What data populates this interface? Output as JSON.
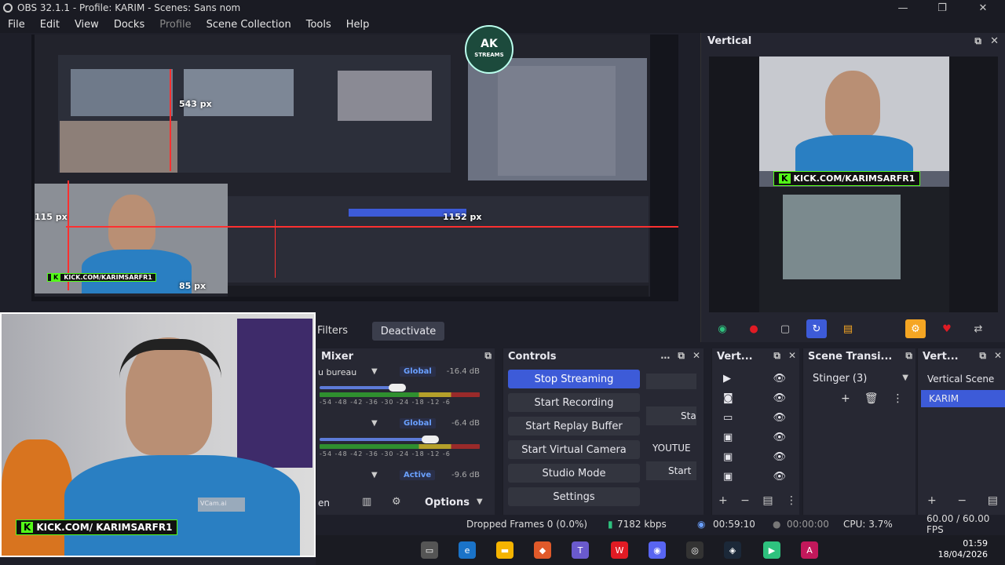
{
  "window": {
    "title": "OBS 32.1.1 - Profile: KARIM - Scenes: Sans nom",
    "controls": [
      "—",
      "❐",
      "✕"
    ]
  },
  "menu": {
    "items": [
      "File",
      "Edit",
      "View",
      "Docks",
      "Profile",
      "Scene Collection",
      "Tools",
      "Help"
    ]
  },
  "preview": {
    "labels": {
      "top": "543 px",
      "right": "1152 px",
      "left": "115 px",
      "bottom": "85 px"
    },
    "kick_text": "KICK.COM/KARIMSARFR1"
  },
  "logo": {
    "main": "AK",
    "sub": "STREAMS"
  },
  "vertical_dock": {
    "title": "Vertical",
    "kick_text": "KICK.COM/KARIMSARFR1"
  },
  "webcam": {
    "kick_text": "KICK.COM/ KARIMSARFR1",
    "watermark": "VCam.ai"
  },
  "toolbar": {
    "filters_label": "Filters",
    "deactivate_label": "Deactivate"
  },
  "mixer": {
    "title": "Mixer",
    "channels": [
      {
        "name": "u bureau",
        "tag": "Global",
        "db": "-16.4 dB"
      },
      {
        "name": "",
        "tag": "Global",
        "db": "-6.4 dB"
      },
      {
        "name": "",
        "tag": "Active",
        "db": "-9.6 dB"
      }
    ],
    "scale": "-54  -48  -42  -36  -30  -24  -18  -12  -6",
    "footer_label": "en",
    "options_label": "Options"
  },
  "controls": {
    "title": "Controls",
    "buttons": [
      "Stop Streaming",
      "Start Recording",
      "Start Replay Buffer",
      "Start Virtual Camera",
      "Studio Mode",
      "Settings"
    ],
    "side_labels": [
      "Sta",
      "YOUTUE",
      "Start"
    ]
  },
  "vert_sources": {
    "title": "Vert..."
  },
  "scene_transitions": {
    "title": "Scene Transi...",
    "selected": "Stinger (3)"
  },
  "vert_scenes": {
    "title": "Vert...",
    "header": "Vertical Scene",
    "selected": "KARIM"
  },
  "status": {
    "dropped": "Dropped Frames 0 (0.0%)",
    "bitrate": "7182 kbps",
    "stream_time": "00:59:10",
    "rec_time": "00:00:00",
    "cpu": "CPU: 3.7%",
    "fps": "60.00 / 60.00 FPS"
  },
  "clock": {
    "time": "01:59",
    "date": "18/04/2026"
  },
  "colors": {
    "accent": "#3d5bd8",
    "kick": "#53fc18",
    "bg": "#272833"
  }
}
